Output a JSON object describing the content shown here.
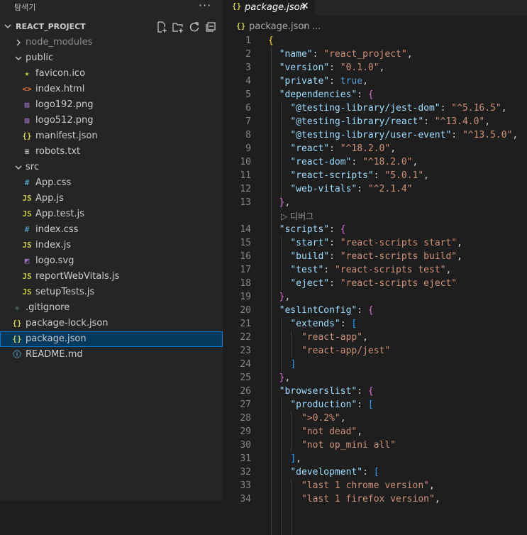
{
  "sidebar": {
    "title": "탐색기",
    "more": "···",
    "project": "REACT_PROJECT",
    "actions": [
      "new-file-icon",
      "new-folder-icon",
      "refresh-icon",
      "collapse-all-icon"
    ],
    "tree": [
      {
        "label": "node_modules",
        "depth": 1,
        "type": "folder",
        "open": false,
        "dim": true
      },
      {
        "label": "public",
        "depth": 1,
        "type": "folder",
        "open": true
      },
      {
        "label": "favicon.ico",
        "depth": 2,
        "icon": "★",
        "color": "#cbcb41"
      },
      {
        "label": "index.html",
        "depth": 2,
        "icon": "<>",
        "color": "#e37933"
      },
      {
        "label": "logo192.png",
        "depth": 2,
        "icon": "▨",
        "color": "#a074c4"
      },
      {
        "label": "logo512.png",
        "depth": 2,
        "icon": "▨",
        "color": "#a074c4"
      },
      {
        "label": "manifest.json",
        "depth": 2,
        "icon": "{}",
        "color": "#cbcb41"
      },
      {
        "label": "robots.txt",
        "depth": 2,
        "icon": "≡",
        "color": "#cccccc"
      },
      {
        "label": "src",
        "depth": 1,
        "type": "folder",
        "open": true
      },
      {
        "label": "App.css",
        "depth": 2,
        "icon": "#",
        "color": "#519aba"
      },
      {
        "label": "App.js",
        "depth": 2,
        "icon": "JS",
        "color": "#cbcb41"
      },
      {
        "label": "App.test.js",
        "depth": 2,
        "icon": "JS",
        "color": "#cbcb41"
      },
      {
        "label": "index.css",
        "depth": 2,
        "icon": "#",
        "color": "#519aba"
      },
      {
        "label": "index.js",
        "depth": 2,
        "icon": "JS",
        "color": "#cbcb41"
      },
      {
        "label": "logo.svg",
        "depth": 2,
        "icon": "◩",
        "color": "#a074c4"
      },
      {
        "label": "reportWebVitals.js",
        "depth": 2,
        "icon": "JS",
        "color": "#cbcb41"
      },
      {
        "label": "setupTests.js",
        "depth": 2,
        "icon": "JS",
        "color": "#cbcb41"
      },
      {
        "label": ".gitignore",
        "depth": 1,
        "icon": "◆",
        "color": "#41535b"
      },
      {
        "label": "package-lock.json",
        "depth": 1,
        "icon": "{}",
        "color": "#cbcb41"
      },
      {
        "label": "package.json",
        "depth": 1,
        "icon": "{}",
        "color": "#cbcb41",
        "selected": true
      },
      {
        "label": "README.md",
        "depth": 1,
        "icon": "ⓘ",
        "color": "#519aba"
      }
    ]
  },
  "editor": {
    "tab": {
      "icon": "{}",
      "label": "package.json",
      "close": "✕"
    },
    "breadcrumb": {
      "icon": "{}",
      "file": "package.json",
      "separator": "›",
      "ellipsis": "..."
    },
    "codelens": {
      "label": "디버그",
      "icon": "▷"
    },
    "lines": [
      {
        "n": "1",
        "t": [
          [
            "p1",
            "{"
          ]
        ]
      },
      {
        "n": "2",
        "t": [
          [
            "pn",
            "  "
          ],
          [
            "k",
            "\"name\""
          ],
          [
            "pn",
            ": "
          ],
          [
            "s",
            "\"react_project\""
          ],
          [
            "pn",
            ","
          ]
        ]
      },
      {
        "n": "3",
        "t": [
          [
            "pn",
            "  "
          ],
          [
            "k",
            "\"version\""
          ],
          [
            "pn",
            ": "
          ],
          [
            "s",
            "\"0.1.0\""
          ],
          [
            "pn",
            ","
          ]
        ]
      },
      {
        "n": "4",
        "t": [
          [
            "pn",
            "  "
          ],
          [
            "k",
            "\"private\""
          ],
          [
            "pn",
            ": "
          ],
          [
            "b",
            "true"
          ],
          [
            "pn",
            ","
          ]
        ]
      },
      {
        "n": "5",
        "t": [
          [
            "pn",
            "  "
          ],
          [
            "k",
            "\"dependencies\""
          ],
          [
            "pn",
            ": "
          ],
          [
            "p2",
            "{"
          ]
        ]
      },
      {
        "n": "6",
        "t": [
          [
            "pn",
            "    "
          ],
          [
            "k",
            "\"@testing-library/jest-dom\""
          ],
          [
            "pn",
            ": "
          ],
          [
            "s",
            "\"^5.16.5\""
          ],
          [
            "pn",
            ","
          ]
        ]
      },
      {
        "n": "7",
        "t": [
          [
            "pn",
            "    "
          ],
          [
            "k",
            "\"@testing-library/react\""
          ],
          [
            "pn",
            ": "
          ],
          [
            "s",
            "\"^13.4.0\""
          ],
          [
            "pn",
            ","
          ]
        ]
      },
      {
        "n": "8",
        "t": [
          [
            "pn",
            "    "
          ],
          [
            "k",
            "\"@testing-library/user-event\""
          ],
          [
            "pn",
            ": "
          ],
          [
            "s",
            "\"^13.5.0\""
          ],
          [
            "pn",
            ","
          ]
        ]
      },
      {
        "n": "9",
        "t": [
          [
            "pn",
            "    "
          ],
          [
            "k",
            "\"react\""
          ],
          [
            "pn",
            ": "
          ],
          [
            "s",
            "\"^18.2.0\""
          ],
          [
            "pn",
            ","
          ]
        ]
      },
      {
        "n": "10",
        "t": [
          [
            "pn",
            "    "
          ],
          [
            "k",
            "\"react-dom\""
          ],
          [
            "pn",
            ": "
          ],
          [
            "s",
            "\"^18.2.0\""
          ],
          [
            "pn",
            ","
          ]
        ]
      },
      {
        "n": "11",
        "t": [
          [
            "pn",
            "    "
          ],
          [
            "k",
            "\"react-scripts\""
          ],
          [
            "pn",
            ": "
          ],
          [
            "s",
            "\"5.0.1\""
          ],
          [
            "pn",
            ","
          ]
        ]
      },
      {
        "n": "12",
        "t": [
          [
            "pn",
            "    "
          ],
          [
            "k",
            "\"web-vitals\""
          ],
          [
            "pn",
            ": "
          ],
          [
            "s",
            "\"^2.1.4\""
          ]
        ]
      },
      {
        "n": "13",
        "t": [
          [
            "pn",
            "  "
          ],
          [
            "p2",
            "}"
          ],
          [
            "pn",
            ","
          ]
        ]
      },
      {
        "lens": true
      },
      {
        "n": "14",
        "t": [
          [
            "pn",
            "  "
          ],
          [
            "k",
            "\"scripts\""
          ],
          [
            "pn",
            ": "
          ],
          [
            "p2",
            "{"
          ]
        ]
      },
      {
        "n": "15",
        "t": [
          [
            "pn",
            "    "
          ],
          [
            "k",
            "\"start\""
          ],
          [
            "pn",
            ": "
          ],
          [
            "s",
            "\"react-scripts start\""
          ],
          [
            "pn",
            ","
          ]
        ]
      },
      {
        "n": "16",
        "t": [
          [
            "pn",
            "    "
          ],
          [
            "k",
            "\"build\""
          ],
          [
            "pn",
            ": "
          ],
          [
            "s",
            "\"react-scripts build\""
          ],
          [
            "pn",
            ","
          ]
        ]
      },
      {
        "n": "17",
        "t": [
          [
            "pn",
            "    "
          ],
          [
            "k",
            "\"test\""
          ],
          [
            "pn",
            ": "
          ],
          [
            "s",
            "\"react-scripts test\""
          ],
          [
            "pn",
            ","
          ]
        ]
      },
      {
        "n": "18",
        "t": [
          [
            "pn",
            "    "
          ],
          [
            "k",
            "\"eject\""
          ],
          [
            "pn",
            ": "
          ],
          [
            "s",
            "\"react-scripts eject\""
          ]
        ]
      },
      {
        "n": "19",
        "t": [
          [
            "pn",
            "  "
          ],
          [
            "p2",
            "}"
          ],
          [
            "pn",
            ","
          ]
        ]
      },
      {
        "n": "20",
        "t": [
          [
            "pn",
            "  "
          ],
          [
            "k",
            "\"eslintConfig\""
          ],
          [
            "pn",
            ": "
          ],
          [
            "p2",
            "{"
          ]
        ]
      },
      {
        "n": "21",
        "t": [
          [
            "pn",
            "    "
          ],
          [
            "k",
            "\"extends\""
          ],
          [
            "pn",
            ": "
          ],
          [
            "p3",
            "["
          ]
        ]
      },
      {
        "n": "22",
        "t": [
          [
            "pn",
            "      "
          ],
          [
            "s",
            "\"react-app\""
          ],
          [
            "pn",
            ","
          ]
        ]
      },
      {
        "n": "23",
        "t": [
          [
            "pn",
            "      "
          ],
          [
            "s",
            "\"react-app/jest\""
          ]
        ]
      },
      {
        "n": "24",
        "t": [
          [
            "pn",
            "    "
          ],
          [
            "p3",
            "]"
          ]
        ]
      },
      {
        "n": "25",
        "t": [
          [
            "pn",
            "  "
          ],
          [
            "p2",
            "}"
          ],
          [
            "pn",
            ","
          ]
        ]
      },
      {
        "n": "26",
        "t": [
          [
            "pn",
            "  "
          ],
          [
            "k",
            "\"browserslist\""
          ],
          [
            "pn",
            ": "
          ],
          [
            "p2",
            "{"
          ]
        ]
      },
      {
        "n": "27",
        "t": [
          [
            "pn",
            "    "
          ],
          [
            "k",
            "\"production\""
          ],
          [
            "pn",
            ": "
          ],
          [
            "p3",
            "["
          ]
        ]
      },
      {
        "n": "28",
        "t": [
          [
            "pn",
            "      "
          ],
          [
            "s",
            "\">0.2%\""
          ],
          [
            "pn",
            ","
          ]
        ]
      },
      {
        "n": "29",
        "t": [
          [
            "pn",
            "      "
          ],
          [
            "s",
            "\"not dead\""
          ],
          [
            "pn",
            ","
          ]
        ]
      },
      {
        "n": "30",
        "t": [
          [
            "pn",
            "      "
          ],
          [
            "s",
            "\"not op_mini all\""
          ]
        ]
      },
      {
        "n": "31",
        "t": [
          [
            "pn",
            "    "
          ],
          [
            "p3",
            "]"
          ],
          [
            "pn",
            ","
          ]
        ]
      },
      {
        "n": "32",
        "t": [
          [
            "pn",
            "    "
          ],
          [
            "k",
            "\"development\""
          ],
          [
            "pn",
            ": "
          ],
          [
            "p3",
            "["
          ]
        ]
      },
      {
        "n": "33",
        "t": [
          [
            "pn",
            "      "
          ],
          [
            "s",
            "\"last 1 chrome version\""
          ],
          [
            "pn",
            ","
          ]
        ]
      },
      {
        "n": "34",
        "t": [
          [
            "pn",
            "      "
          ],
          [
            "s",
            "\"last 1 firefox version\""
          ],
          [
            "pn",
            ","
          ]
        ]
      }
    ]
  }
}
